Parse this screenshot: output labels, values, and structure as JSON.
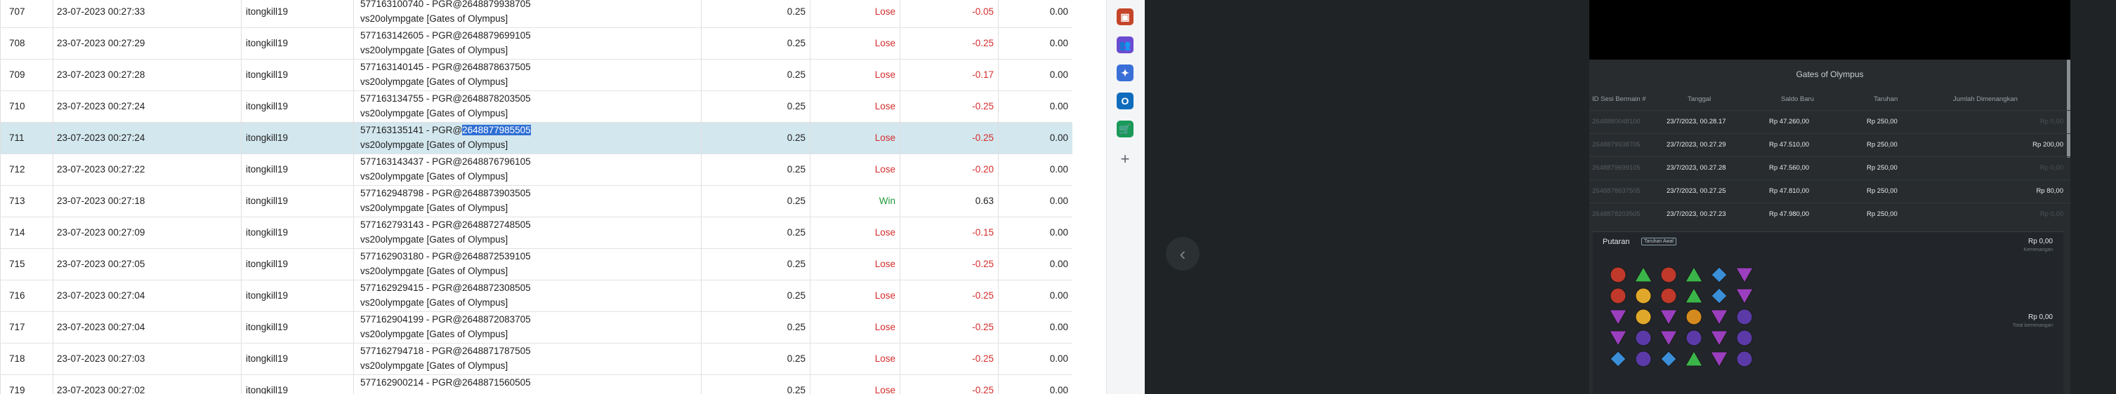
{
  "table": {
    "rows": [
      {
        "no": "707",
        "date": "23-07-2023 00:27:33",
        "user": "itongkill19",
        "desc_line1": "577163100740 - PGR@2648879938705",
        "desc_line2": "vs20olympgate [Gates of Olympus]",
        "bet": "0.25",
        "result": "Lose",
        "amount": "-0.05",
        "extra": "0.00"
      },
      {
        "no": "708",
        "date": "23-07-2023 00:27:29",
        "user": "itongkill19",
        "desc_line1": "577163142605 - PGR@2648879699105",
        "desc_line2": "vs20olympgate [Gates of Olympus]",
        "bet": "0.25",
        "result": "Lose",
        "amount": "-0.25",
        "extra": "0.00"
      },
      {
        "no": "709",
        "date": "23-07-2023 00:27:28",
        "user": "itongkill19",
        "desc_line1": "577163140145 - PGR@2648878637505",
        "desc_line2": "vs20olympgate [Gates of Olympus]",
        "bet": "0.25",
        "result": "Lose",
        "amount": "-0.17",
        "extra": "0.00"
      },
      {
        "no": "710",
        "date": "23-07-2023 00:27:24",
        "user": "itongkill19",
        "desc_line1": "577163134755 - PGR@2648878203505",
        "desc_line2": "vs20olympgate [Gates of Olympus]",
        "bet": "0.25",
        "result": "Lose",
        "amount": "-0.25",
        "extra": "0.00"
      },
      {
        "no": "711",
        "date": "23-07-2023 00:27:24",
        "user": "itongkill19",
        "desc_line1_prefix": "577163135141 - PGR@",
        "desc_line1_selected": "2648877985505",
        "desc_line2": "vs20olympgate [Gates of Olympus]",
        "bet": "0.25",
        "result": "Lose",
        "amount": "-0.25",
        "extra": "0.00"
      },
      {
        "no": "712",
        "date": "23-07-2023 00:27:22",
        "user": "itongkill19",
        "desc_line1": "577163143437 - PGR@2648876796105",
        "desc_line2": "vs20olympgate [Gates of Olympus]",
        "bet": "0.25",
        "result": "Lose",
        "amount": "-0.20",
        "extra": "0.00"
      },
      {
        "no": "713",
        "date": "23-07-2023 00:27:18",
        "user": "itongkill19",
        "desc_line1": "577162948798 - PGR@2648873903505",
        "desc_line2": "vs20olympgate [Gates of Olympus]",
        "bet": "0.25",
        "result": "Win",
        "amount": "0.63",
        "extra": "0.00"
      },
      {
        "no": "714",
        "date": "23-07-2023 00:27:09",
        "user": "itongkill19",
        "desc_line1": "577162793143 - PGR@2648872748505",
        "desc_line2": "vs20olympgate [Gates of Olympus]",
        "bet": "0.25",
        "result": "Lose",
        "amount": "-0.15",
        "extra": "0.00"
      },
      {
        "no": "715",
        "date": "23-07-2023 00:27:05",
        "user": "itongkill19",
        "desc_line1": "577162903180 - PGR@2648872539105",
        "desc_line2": "vs20olympgate [Gates of Olympus]",
        "bet": "0.25",
        "result": "Lose",
        "amount": "-0.25",
        "extra": "0.00"
      },
      {
        "no": "716",
        "date": "23-07-2023 00:27:04",
        "user": "itongkill19",
        "desc_line1": "577162929415 - PGR@2648872308505",
        "desc_line2": "vs20olympgate [Gates of Olympus]",
        "bet": "0.25",
        "result": "Lose",
        "amount": "-0.25",
        "extra": "0.00"
      },
      {
        "no": "717",
        "date": "23-07-2023 00:27:04",
        "user": "itongkill19",
        "desc_line1": "577162904199 - PGR@2648872083705",
        "desc_line2": "vs20olympgate [Gates of Olympus]",
        "bet": "0.25",
        "result": "Lose",
        "amount": "-0.25",
        "extra": "0.00"
      },
      {
        "no": "718",
        "date": "23-07-2023 00:27:03",
        "user": "itongkill19",
        "desc_line1": "577162794718 - PGR@2648871787505",
        "desc_line2": "vs20olympgate [Gates of Olympus]",
        "bet": "0.25",
        "result": "Lose",
        "amount": "-0.25",
        "extra": "0.00"
      },
      {
        "no": "719",
        "date": "23-07-2023 00:27:02",
        "user": "itongkill19",
        "desc_line1": "577162900214 - PGR@2648871560505",
        "desc_line2": "",
        "bet": "0.25",
        "result": "Lose",
        "amount": "-0.25",
        "extra": "0.00"
      }
    ]
  },
  "sidebar": {
    "icons": [
      {
        "name": "briefcase-icon",
        "glyph": "▣",
        "color": "#c5452a"
      },
      {
        "name": "people-icon",
        "glyph": "👥",
        "color": "#6b4bd1"
      },
      {
        "name": "copilot-icon",
        "glyph": "✦",
        "color": "#3a6fd8"
      },
      {
        "name": "outlook-icon",
        "glyph": "O",
        "color": "#0f6cbd"
      },
      {
        "name": "shopping-icon",
        "glyph": "🛒",
        "color": "#1a9a5a"
      },
      {
        "name": "add-icon",
        "glyph": "+",
        "color": "transparent"
      }
    ]
  },
  "game_panel": {
    "title": "Gates of Olympus",
    "headers": {
      "id": "ID Sesi Bermain #",
      "date": "Tanggal",
      "balance": "Saldo Baru",
      "bet": "Taruhan",
      "win": "Jumlah Dimenangkan"
    },
    "rows": [
      {
        "id": "2648880048100",
        "date": "23/7/2023, 00.28.17",
        "balance": "Rp 47.260,00",
        "bet": "Rp 250,00",
        "win": "Rp 0,00"
      },
      {
        "id": "2648879938705",
        "date": "23/7/2023, 00.27.29",
        "balance": "Rp 47.510,00",
        "bet": "Rp 250,00",
        "win": "Rp 200,00"
      },
      {
        "id": "2648879699105",
        "date": "23/7/2023, 00.27.28",
        "balance": "Rp 47.560,00",
        "bet": "Rp 250,00",
        "win": "Rp 0,00"
      },
      {
        "id": "2648878637505",
        "date": "23/7/2023, 00.27.25",
        "balance": "Rp 47.810,00",
        "bet": "Rp 250,00",
        "win": "Rp 80,00"
      },
      {
        "id": "2648878203505",
        "date": "23/7/2023, 00.27.23",
        "balance": "Rp 47.980,00",
        "bet": "Rp 250,00",
        "win": "Rp 0,00"
      }
    ],
    "spin": {
      "label": "Putaran",
      "tag": "Taruhan Awal",
      "amount_top": "Rp 0,00",
      "sub_top": "Kemenangan",
      "amount_bottom": "Rp 0,00",
      "sub_bottom": "Total kemenangan"
    },
    "reel_symbols": [
      [
        "ruby",
        "green",
        "ruby",
        "green",
        "blue",
        "purple"
      ],
      [
        "ruby",
        "gold",
        "ruby",
        "green",
        "blue",
        "purple"
      ],
      [
        "purple",
        "gold",
        "purple",
        "crown",
        "purple",
        "ring"
      ],
      [
        "purple",
        "ring",
        "purple",
        "ring",
        "purple",
        "ring"
      ],
      [
        "blue",
        "ring",
        "blue",
        "green",
        "purple",
        "ring"
      ]
    ]
  },
  "colors": {
    "lose": "#d62c2c",
    "win": "#1f9a3a",
    "selected_row": "#d3e7ee",
    "highlight": "#2f6fd4",
    "dark_bg": "#1f2325"
  }
}
